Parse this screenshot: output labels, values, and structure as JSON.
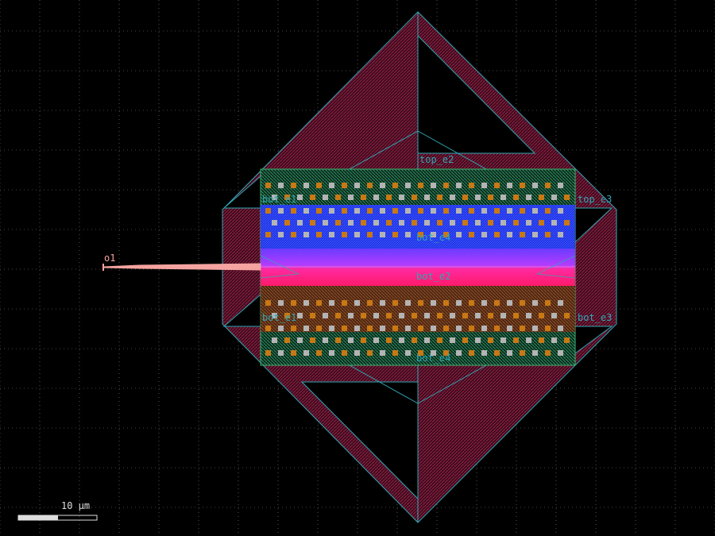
{
  "ports": {
    "o1": "o1",
    "top_e2": "top_e2",
    "top_e3": "top_e3",
    "top_e4": "bot_e4",
    "mid_e2": "bot_e2",
    "bot_e3": "bot_e3",
    "bot_e4": "bot_e4",
    "top_e1": "bot_e1",
    "bot_e1": "bot_e1"
  },
  "scale_bar": {
    "label": "10 μm"
  },
  "colors": {
    "background": "#000000",
    "grid": "#9a9a9a",
    "outline": "#2fa6b4",
    "via": "#3cb371",
    "metal_fill": "#7a1838",
    "waveguide": "#f5a3a0",
    "top_band": "#1f3cff",
    "mid_band_top": "#a23cff",
    "mid_band_bottom": "#ff1a8c",
    "bottom_band": "#a23c1e",
    "contact_orange": "#c87814",
    "contact_grey": "#b4b4b4",
    "label_port": "#2fa6b4",
    "label_o1": "#f5a3a0"
  }
}
